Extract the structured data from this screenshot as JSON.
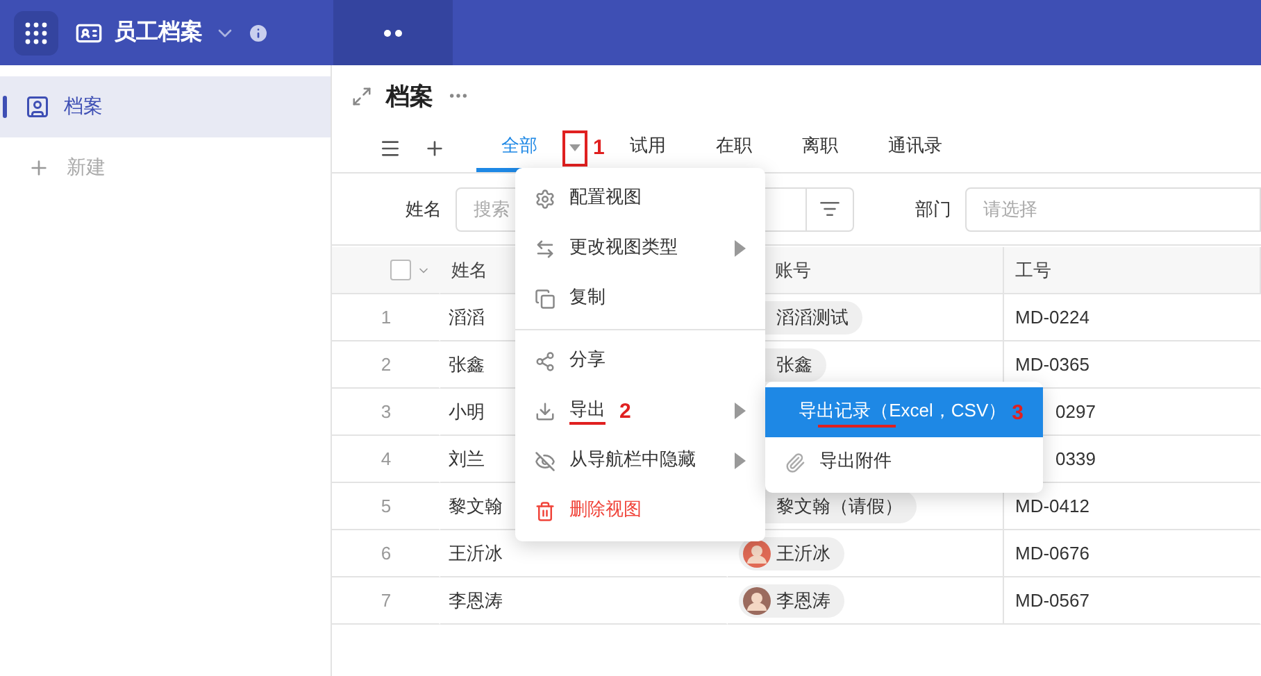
{
  "header": {
    "app_title": "员工档案"
  },
  "sidebar": {
    "items": [
      {
        "label": "档案",
        "selected": true
      }
    ],
    "new_label": "新建"
  },
  "page": {
    "title": "档案"
  },
  "view_tabs": {
    "tabs": [
      {
        "label": "全部",
        "selected": true,
        "has_dropdown": true,
        "annotation": "1"
      },
      {
        "label": "试用",
        "selected": false
      },
      {
        "label": "在职",
        "selected": false
      },
      {
        "label": "离职",
        "selected": false
      },
      {
        "label": "通讯录",
        "selected": false
      }
    ]
  },
  "filters": [
    {
      "label": "姓名",
      "placeholder": "搜索",
      "kind": "search"
    },
    {
      "label": "部门",
      "placeholder": "请选择",
      "kind": "select"
    }
  ],
  "table": {
    "select_all_checked": false,
    "columns": [
      "姓名",
      "账号",
      "工号"
    ],
    "rows": [
      {
        "index": "1",
        "name": "滔滔",
        "account": "滔滔测试",
        "avatar": false,
        "id": "MD-0224"
      },
      {
        "index": "2",
        "name": "张鑫",
        "account": "张鑫",
        "avatar": false,
        "id": "MD-0365"
      },
      {
        "index": "3",
        "name": "小明",
        "id": "0297",
        "id_covered": true
      },
      {
        "index": "4",
        "name": "刘兰",
        "id": "0339",
        "id_covered": true
      },
      {
        "index": "5",
        "name": "黎文翰",
        "account": "黎文翰（请假）",
        "avatar": false,
        "id": "MD-0412"
      },
      {
        "index": "6",
        "name": "王沂冰",
        "account": "王沂冰",
        "avatar": true,
        "id": "MD-0676"
      },
      {
        "index": "7",
        "name": "李恩涛",
        "account": "李恩涛",
        "avatar": true,
        "id": "MD-0567"
      }
    ]
  },
  "view_menu": {
    "items": [
      {
        "kind": "item",
        "label": "配置视图",
        "submenu": false
      },
      {
        "kind": "item",
        "label": "更改视图类型",
        "submenu": true
      },
      {
        "kind": "item",
        "label": "复制",
        "submenu": false
      },
      {
        "kind": "divider"
      },
      {
        "kind": "item",
        "label": "分享",
        "submenu": false
      },
      {
        "kind": "item",
        "label": "导出",
        "submenu": true,
        "annotation": "2",
        "underlined": true
      },
      {
        "kind": "item",
        "label": "从导航栏中隐藏",
        "submenu": true
      },
      {
        "kind": "danger",
        "label": "删除视图",
        "submenu": false
      }
    ]
  },
  "export_menu": {
    "items": [
      {
        "label": "导出记录（Excel，CSV）",
        "selected": true,
        "annotation": "3",
        "underlined": true
      },
      {
        "label": "导出附件",
        "selected": false,
        "underlined": false
      }
    ]
  }
}
